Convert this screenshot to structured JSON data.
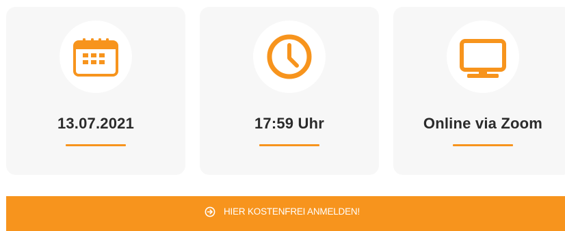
{
  "colors": {
    "accent": "#f7941d",
    "card_background": "#f7f7f7",
    "text": "#2b2b2b",
    "button_text": "#ffffff"
  },
  "cards": [
    {
      "icon": "calendar-icon",
      "label": "13.07.2021"
    },
    {
      "icon": "clock-icon",
      "label": "17:59 Uhr"
    },
    {
      "icon": "monitor-icon",
      "label": "Online via Zoom"
    }
  ],
  "cta": {
    "icon": "arrow-circle-right-icon",
    "label": "HIER KOSTENFREI ANMELDEN!"
  }
}
